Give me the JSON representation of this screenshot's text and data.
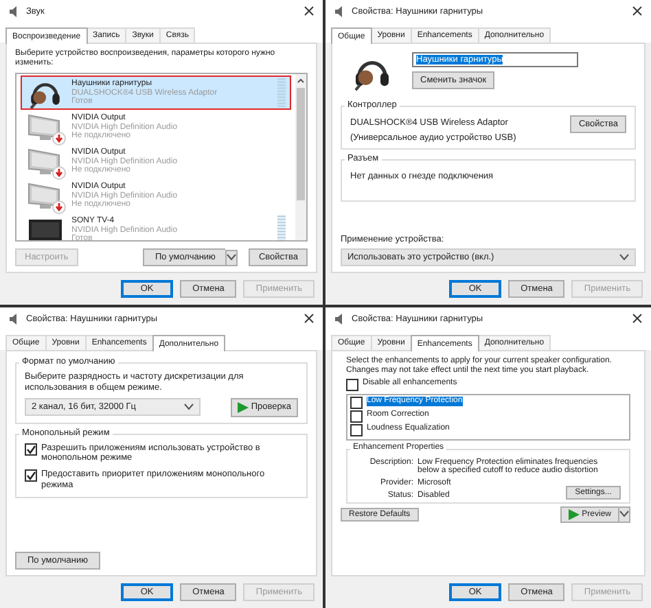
{
  "panels": [
    {
      "kind": "sound",
      "title": "Звук",
      "tabs": [
        {
          "label": "Воспроизведение",
          "selected": true
        },
        {
          "label": "Запись",
          "selected": false
        },
        {
          "label": "Звуки",
          "selected": false
        },
        {
          "label": "Связь",
          "selected": false
        }
      ],
      "prompt": "Выберите устройство воспроизведения, параметры которого нужно изменить:",
      "devices": [
        {
          "kind": "headset",
          "name": "Наушники гарнитуры",
          "driver": "DUALSHOCK®4 USB Wireless Adaptor",
          "status": "Готов",
          "connected": true,
          "selected": true
        },
        {
          "kind": "monitor",
          "name": "NVIDIA Output",
          "driver": "NVIDIA High Definition Audio",
          "status": "Не подключено",
          "connected": false,
          "selected": false
        },
        {
          "kind": "monitor",
          "name": "NVIDIA Output",
          "driver": "NVIDIA High Definition Audio",
          "status": "Не подключено",
          "connected": false,
          "selected": false
        },
        {
          "kind": "monitor",
          "name": "NVIDIA Output",
          "driver": "NVIDIA High Definition Audio",
          "status": "Не подключено",
          "connected": false,
          "selected": false
        },
        {
          "kind": "tv",
          "name": "SONY TV-4",
          "driver": "NVIDIA High Definition Audio",
          "status": "Готов",
          "connected": true,
          "selected": false
        }
      ],
      "actions": [
        {
          "label": "Настроить",
          "disabled": true,
          "dropdown": false
        },
        {
          "label": "По умолчанию",
          "disabled": false,
          "dropdown": true
        },
        {
          "label": "Свойства",
          "disabled": false,
          "dropdown": false
        }
      ],
      "footer": [
        {
          "label": "OK",
          "disabled": false,
          "focused": true
        },
        {
          "label": "Отмена",
          "disabled": false,
          "focused": false
        },
        {
          "label": "Применить",
          "disabled": true,
          "focused": false
        }
      ]
    },
    {
      "kind": "general",
      "title": "Свойства: Наушники гарнитуры",
      "tabs": [
        {
          "label": "Общие",
          "selected": true
        },
        {
          "label": "Уровни",
          "selected": false
        },
        {
          "label": "Enhancements",
          "selected": false
        },
        {
          "label": "Дополнительно",
          "selected": false
        }
      ],
      "name_value": "Наушники гарнитуры",
      "change_icon": "Сменить значок",
      "controller": {
        "title": "Контроллер",
        "line1": "DUALSHOCK®4 USB Wireless Adaptor",
        "line2": "(Универсальное аудио устройство USB)",
        "button": "Свойства"
      },
      "jack": {
        "title": "Разъем",
        "text": "Нет данных о гнезде подключения"
      },
      "usage_label": "Применение устройства:",
      "usage_value": "Использовать это устройство (вкл.)",
      "footer": [
        {
          "label": "OK",
          "disabled": false,
          "focused": true
        },
        {
          "label": "Отмена",
          "disabled": false,
          "focused": false
        },
        {
          "label": "Применить",
          "disabled": true,
          "focused": false
        }
      ]
    },
    {
      "kind": "advanced",
      "title": "Свойства: Наушники гарнитуры",
      "tabs": [
        {
          "label": "Общие",
          "selected": false
        },
        {
          "label": "Уровни",
          "selected": false
        },
        {
          "label": "Enhancements",
          "selected": false
        },
        {
          "label": "Дополнительно",
          "selected": true
        }
      ],
      "format": {
        "title": "Формат по умолчанию",
        "text": "Выберите разрядность и частоту дискретизации для использования в общем режиме.",
        "value": "2 канал, 16 бит, 32000 Гц",
        "test": "Проверка"
      },
      "exclusive": {
        "title": "Монопольный режим",
        "options": [
          {
            "label": "Разрешить приложениям использовать устройство в монопольном режиме",
            "checked": true
          },
          {
            "label": "Предоставить приоритет приложениям монопольного режима",
            "checked": true
          }
        ]
      },
      "restore": "По умолчанию",
      "footer": [
        {
          "label": "OK",
          "disabled": false,
          "focused": true
        },
        {
          "label": "Отмена",
          "disabled": false,
          "focused": false
        },
        {
          "label": "Применить",
          "disabled": true,
          "focused": false
        }
      ]
    },
    {
      "kind": "enhancements",
      "title": "Свойства: Наушники гарнитуры",
      "tabs": [
        {
          "label": "Общие",
          "selected": false
        },
        {
          "label": "Уровни",
          "selected": false
        },
        {
          "label": "Enhancements",
          "selected": true
        },
        {
          "label": "Дополнительно",
          "selected": false
        }
      ],
      "intro": "Select the enhancements to apply for your current speaker configuration. Changes may not take effect until the next time you start playback.",
      "disable_all": {
        "label": "Disable all enhancements",
        "checked": false
      },
      "enhancements": [
        {
          "label": "Low Frequency Protection",
          "checked": false,
          "selected": true
        },
        {
          "label": "Room Correction",
          "checked": false,
          "selected": false
        },
        {
          "label": "Loudness Equalization",
          "checked": false,
          "selected": false
        }
      ],
      "properties": {
        "title": "Enhancement Properties",
        "rows": [
          {
            "key": "Description:",
            "value": "Low Frequency Protection eliminates frequencies below a specified cutoff to reduce audio distortion"
          },
          {
            "key": "Provider:",
            "value": "Microsoft"
          },
          {
            "key": "Status:",
            "value": "Disabled"
          }
        ],
        "settings": "Settings..."
      },
      "restore": "Restore Defaults",
      "preview": "Preview",
      "footer": [
        {
          "label": "OK",
          "disabled": false,
          "focused": true
        },
        {
          "label": "Отмена",
          "disabled": false,
          "focused": false
        },
        {
          "label": "Применить",
          "disabled": true,
          "focused": false
        }
      ]
    }
  ]
}
